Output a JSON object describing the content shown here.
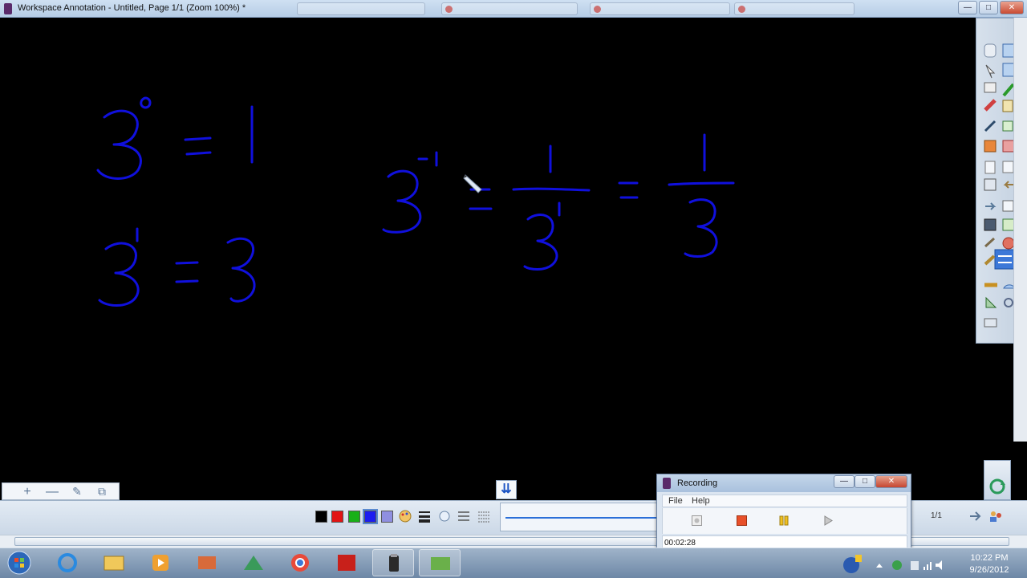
{
  "window": {
    "title": "Workspace Annotation - Untitled, Page 1/1  (Zoom 100%) *",
    "minimize": "—",
    "maximize": "□",
    "close": "✕"
  },
  "canvas": {
    "ink_color": "#1010dd",
    "background": "#000000"
  },
  "page_buttons": {
    "add": "+",
    "remove": "—",
    "edit": "✎",
    "copy": "⧉"
  },
  "bottom_toolbar": {
    "down_arrows": "⇊",
    "colors": [
      "#000000",
      "#e11414",
      "#18b018",
      "#1c1cf0",
      "#8f8fe0"
    ],
    "page_count": "1/1",
    "icons": [
      "palette-icon",
      "line-width-icon",
      "highlighter-icon",
      "line-spacing-icon",
      "grid-icon"
    ]
  },
  "recording": {
    "title": "Recording",
    "minimize": "—",
    "maximize": "□",
    "close": "✕",
    "menu": [
      "File",
      "Help"
    ],
    "time": "00:02:28"
  },
  "taskbar": {
    "time": "10:22 PM",
    "date": "9/26/2012"
  }
}
